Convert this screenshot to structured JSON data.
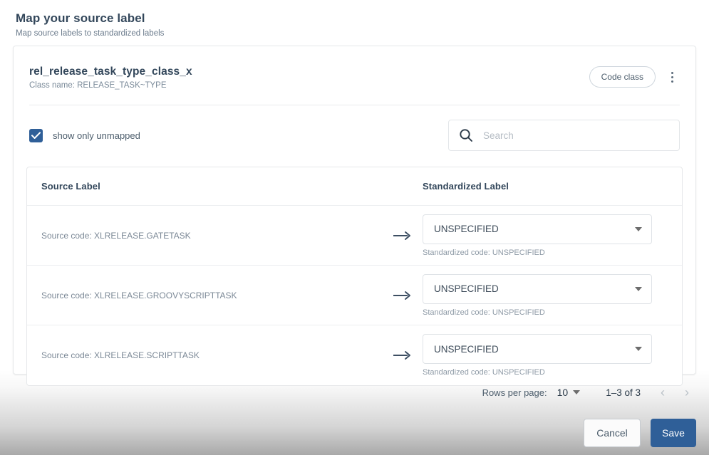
{
  "page": {
    "title": "Map your source label",
    "subtitle": "Map source labels to standardized labels"
  },
  "card": {
    "class_name": "rel_release_task_type_class_x",
    "class_name_label": "Class name: RELEASE_TASK~TYPE",
    "chip_label": "Code class",
    "kebab_icon": "more-vertical-icon"
  },
  "controls": {
    "checkbox_label": "show only unmapped",
    "checkbox_checked": true,
    "search_placeholder": "Search",
    "search_value": "",
    "search_icon": "search-icon"
  },
  "table": {
    "headers": {
      "source": "Source Label",
      "standardized": "Standardized Label"
    },
    "arrow_icon": "arrow-right-icon",
    "rows": [
      {
        "source_code": "Source code: XLRELEASE.GATETASK",
        "standardized_value": "UNSPECIFIED",
        "standardized_code": "Standardized code: UNSPECIFIED"
      },
      {
        "source_code": "Source code: XLRELEASE.GROOVYSCRIPTTASK",
        "standardized_value": "UNSPECIFIED",
        "standardized_code": "Standardized code: UNSPECIFIED"
      },
      {
        "source_code": "Source code: XLRELEASE.SCRIPTTASK",
        "standardized_value": "UNSPECIFIED",
        "standardized_code": "Standardized code: UNSPECIFIED"
      }
    ]
  },
  "pagination": {
    "rows_per_page_label": "Rows per page:",
    "rows_per_page_value": "10",
    "range": "1–3 of 3",
    "prev_icon": "‹",
    "next_icon": "›"
  },
  "actions": {
    "cancel_label": "Cancel",
    "save_label": "Save"
  },
  "colors": {
    "accent": "#2f5f98",
    "title_text": "#33475b",
    "muted_text": "#7b8896",
    "border": "#e6e8ea"
  }
}
